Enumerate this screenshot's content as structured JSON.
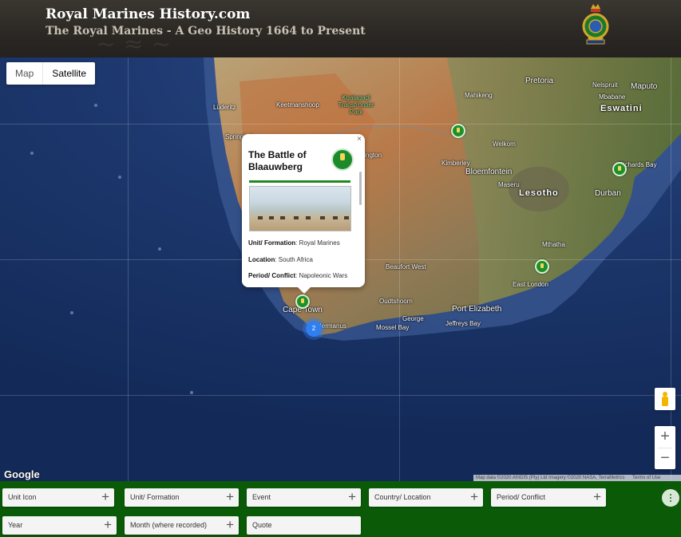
{
  "header": {
    "title": "Royal Marines History.com",
    "subtitle": "The Royal Marines - A Geo History 1664 to Present",
    "crest_icon": "royal-marines-crest-icon"
  },
  "map": {
    "type_control": {
      "map_label": "Map",
      "satellite_label": "Satellite",
      "active": "Satellite"
    },
    "places": {
      "pretoria": "Pretoria",
      "maputo": "Maputo",
      "nelspruit": "Nelspruit",
      "mbabane": "Mbabane",
      "eswatini": "Eswatini",
      "mahikeng": "Mahikeng",
      "welkom": "Welkom",
      "kimberley": "Kimberley",
      "bloemfontein": "Bloemfontein",
      "maseru": "Maseru",
      "lesotho": "Lesotho",
      "durban": "Durban",
      "richards_bay": "Richards Bay",
      "mthatha": "Mthatha",
      "east_london": "East London",
      "port_elizabeth": "Port Elizabeth",
      "jeffreys_bay": "Jeffreys Bay",
      "george": "George",
      "mossel_bay": "Mossel Bay",
      "oudtshoorn": "Oudtshoorn",
      "beaufort_west": "Beaufort West",
      "cape_town": "Cape Town",
      "hermanus": "Hermanus",
      "keetmanshoop": "Keetmanshoop",
      "luderitz": "Lüderitz",
      "upington": "Upington",
      "springbok": "Springbok",
      "kgalagadi": "Kgalagadi Transfrontier Park"
    },
    "popup": {
      "title": "The Battle of Blaauwberg",
      "close": "×",
      "unit_label": "Unit/ Formation",
      "unit_value": "Royal Marines",
      "location_label": "Location",
      "location_value": "South Africa",
      "period_label": "Period/ Conflict",
      "period_value": "Napoleonic Wars"
    },
    "cluster_count": "2",
    "zoom_in": "+",
    "zoom_out": "−",
    "logo": "Google",
    "attribution": {
      "data": "Map data ©2020 AfriGIS (Pty) Ltd Imagery ©2020 NASA, TerraMetrics",
      "terms": "Terms of Use"
    }
  },
  "filters": [
    {
      "label": "Unit Icon",
      "icon": "plus-icon"
    },
    {
      "label": "Unit/ Formation",
      "icon": "plus-icon"
    },
    {
      "label": "Event",
      "icon": "plus-icon"
    },
    {
      "label": "Country/ Location",
      "icon": "plus-icon"
    },
    {
      "label": "Period/ Conflict",
      "icon": "plus-icon"
    },
    {
      "label": "Year",
      "icon": "plus-icon"
    },
    {
      "label": "Month (where recorded)",
      "icon": "plus-icon"
    },
    {
      "label": "Quote",
      "icon": "plus-icon"
    }
  ],
  "plus_symbol": "+",
  "colors": {
    "header_bg": "#2b2824",
    "filter_bar": "#0a5a07",
    "marker": "#1f8f2a",
    "cluster": "#2f7ff0"
  }
}
